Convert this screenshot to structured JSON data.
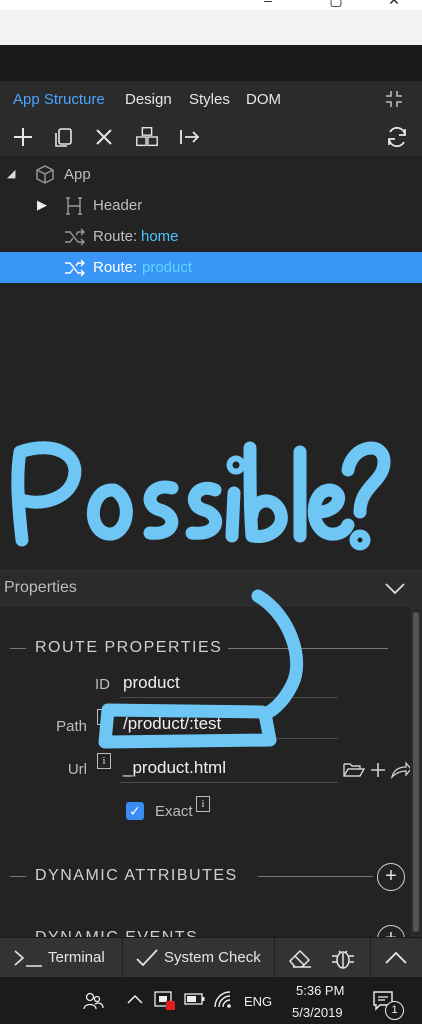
{
  "tabs": {
    "app_structure": "App Structure",
    "design": "Design",
    "styles": "Styles",
    "dom": "DOM"
  },
  "tree": {
    "app_label": "App",
    "header_label": "Header",
    "route_home_prefix": "Route:",
    "route_home_value": "home",
    "route_product_prefix": "Route:",
    "route_product_value": "product"
  },
  "annotation": {
    "handwritten_text": "Possible?"
  },
  "properties": {
    "header_label": "Properties",
    "route_section": "ROUTE PROPERTIES",
    "id_label": "ID",
    "id_value": "product",
    "path_label": "Path",
    "path_value": "/product/:test",
    "url_label": "Url",
    "url_value": "_product.html",
    "exact_label": "Exact",
    "exact_checked": true,
    "dynamic_attributes": "DYNAMIC ATTRIBUTES",
    "dynamic_events": "DYNAMIC EVENTS"
  },
  "bottombar": {
    "terminal": "Terminal",
    "system_check": "System Check"
  },
  "taskbar": {
    "language": "ENG",
    "time": "5:36 PM",
    "date": "5/3/2019",
    "notification_count": "1"
  },
  "colors": {
    "accent_blue": "#3a96f6",
    "highlight_text": "#4cc3ff",
    "scribble": "#6ec6f5"
  }
}
